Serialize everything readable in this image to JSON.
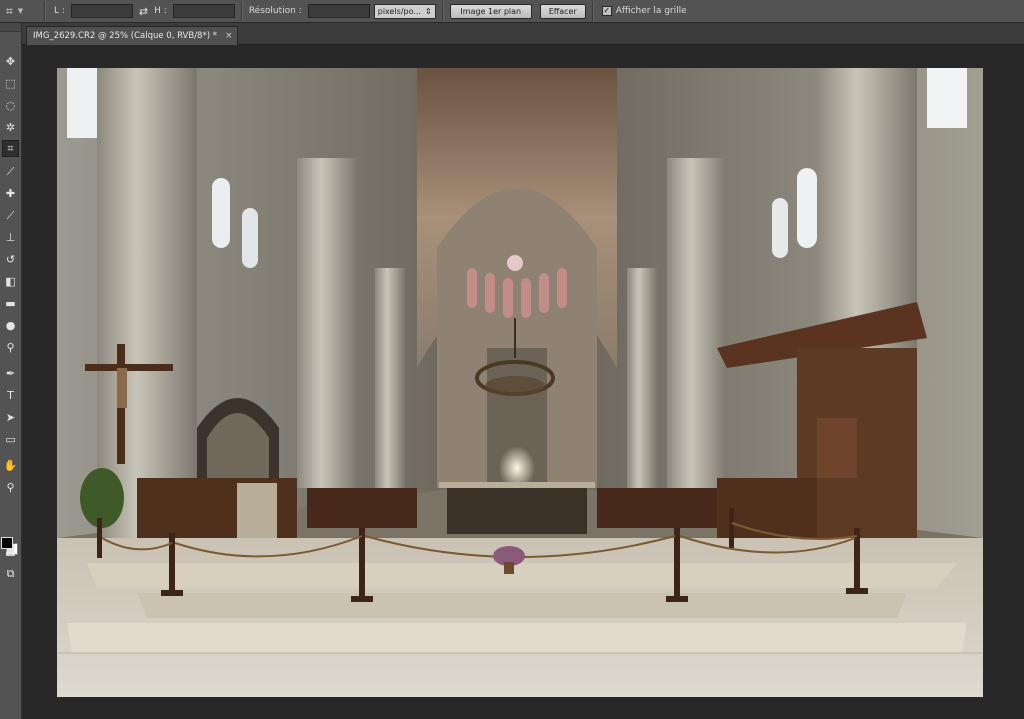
{
  "options_bar": {
    "tool_icon": "crop-tool-icon",
    "width_label": "L :",
    "width_value": "",
    "swap_icon": "swap-arrows-icon",
    "height_label": "H :",
    "height_value": "",
    "resolution_label": "Résolution :",
    "resolution_value": "",
    "unit_selected": "pixels/po...",
    "front_image_button": "Image 1er plan",
    "clear_button": "Effacer",
    "show_grid_checked": true,
    "show_grid_label": "Afficher la grille"
  },
  "document_tab": {
    "title": "IMG_2629.CR2 @ 25% (Calque 0, RVB/8*) *",
    "close_glyph": "×"
  },
  "tools": [
    "move-tool-icon",
    "marquee-tool-icon",
    "lasso-tool-icon",
    "quick-selection-tool-icon",
    "crop-tool-icon",
    "eyedropper-tool-icon",
    "spot-healing-brush-icon",
    "brush-tool-icon",
    "clone-stamp-icon",
    "history-brush-icon",
    "eraser-tool-icon",
    "gradient-tool-icon",
    "blur-tool-icon",
    "dodge-tool-icon",
    "pen-tool-icon",
    "type-tool-icon",
    "path-selection-tool-icon",
    "rectangle-tool-icon",
    "hand-tool-icon",
    "zoom-tool-icon",
    "quick-mask-icon",
    "screen-mode-icon"
  ],
  "colors": {
    "foreground": "#000000",
    "background": "#ffffff",
    "panel": "#535353",
    "canvas_bg": "#282828"
  }
}
